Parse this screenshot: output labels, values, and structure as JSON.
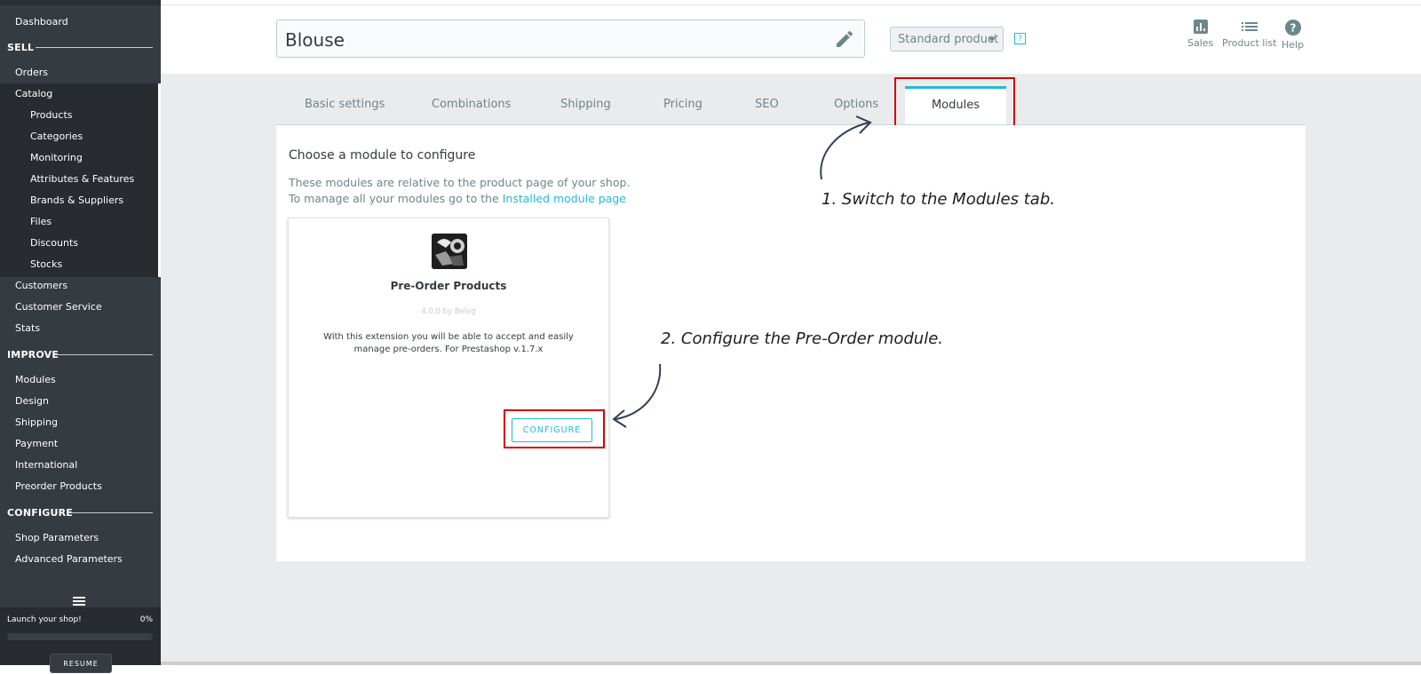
{
  "sidebar": {
    "dashboard": "Dashboard",
    "sell_section": "SELL",
    "orders": "Orders",
    "catalog": "Catalog",
    "catalog_items": [
      "Products",
      "Categories",
      "Monitoring",
      "Attributes & Features",
      "Brands & Suppliers",
      "Files",
      "Discounts",
      "Stocks"
    ],
    "customers": "Customers",
    "customer_service": "Customer Service",
    "stats": "Stats",
    "improve_section": "IMPROVE",
    "improve_items": [
      "Modules",
      "Design",
      "Shipping",
      "Payment",
      "International",
      "Preorder Products"
    ],
    "configure_section": "CONFIGURE",
    "configure_items": [
      "Shop Parameters",
      "Advanced Parameters"
    ],
    "launch_text": "Launch your shop!",
    "launch_pct": "0%",
    "resume_label": "RESUME"
  },
  "header": {
    "product_name": "Blouse",
    "product_type": "Standard product",
    "help_badge": "?",
    "sales_label": "Sales",
    "product_list_label": "Product list",
    "help_label": "Help"
  },
  "tabs": {
    "basic_settings": "Basic settings",
    "combinations": "Combinations",
    "shipping": "Shipping",
    "pricing": "Pricing",
    "seo": "SEO",
    "options": "Options",
    "modules": "Modules"
  },
  "panel": {
    "title": "Choose a module to configure",
    "desc_line1": "These modules are relative to the product page of your shop.",
    "desc_line2_prefix": "To manage all your modules go to the ",
    "desc_link": "Installed module page"
  },
  "module": {
    "name": "Pre-Order Products",
    "version": "4.0.0 by Belvg",
    "description": "With this extension you will be able to accept and easily manage pre-orders. For Prestashop v.1.7.x",
    "configure_label": "CONFIGURE"
  },
  "annotations": {
    "step1": "1. Switch to the Modules tab.",
    "step2": "2. Configure the Pre-Order module."
  },
  "colors": {
    "sidebar_bg": "#363a41",
    "accent": "#25b9d7",
    "highlight": "#d40000",
    "main_bg": "#eaebec"
  }
}
